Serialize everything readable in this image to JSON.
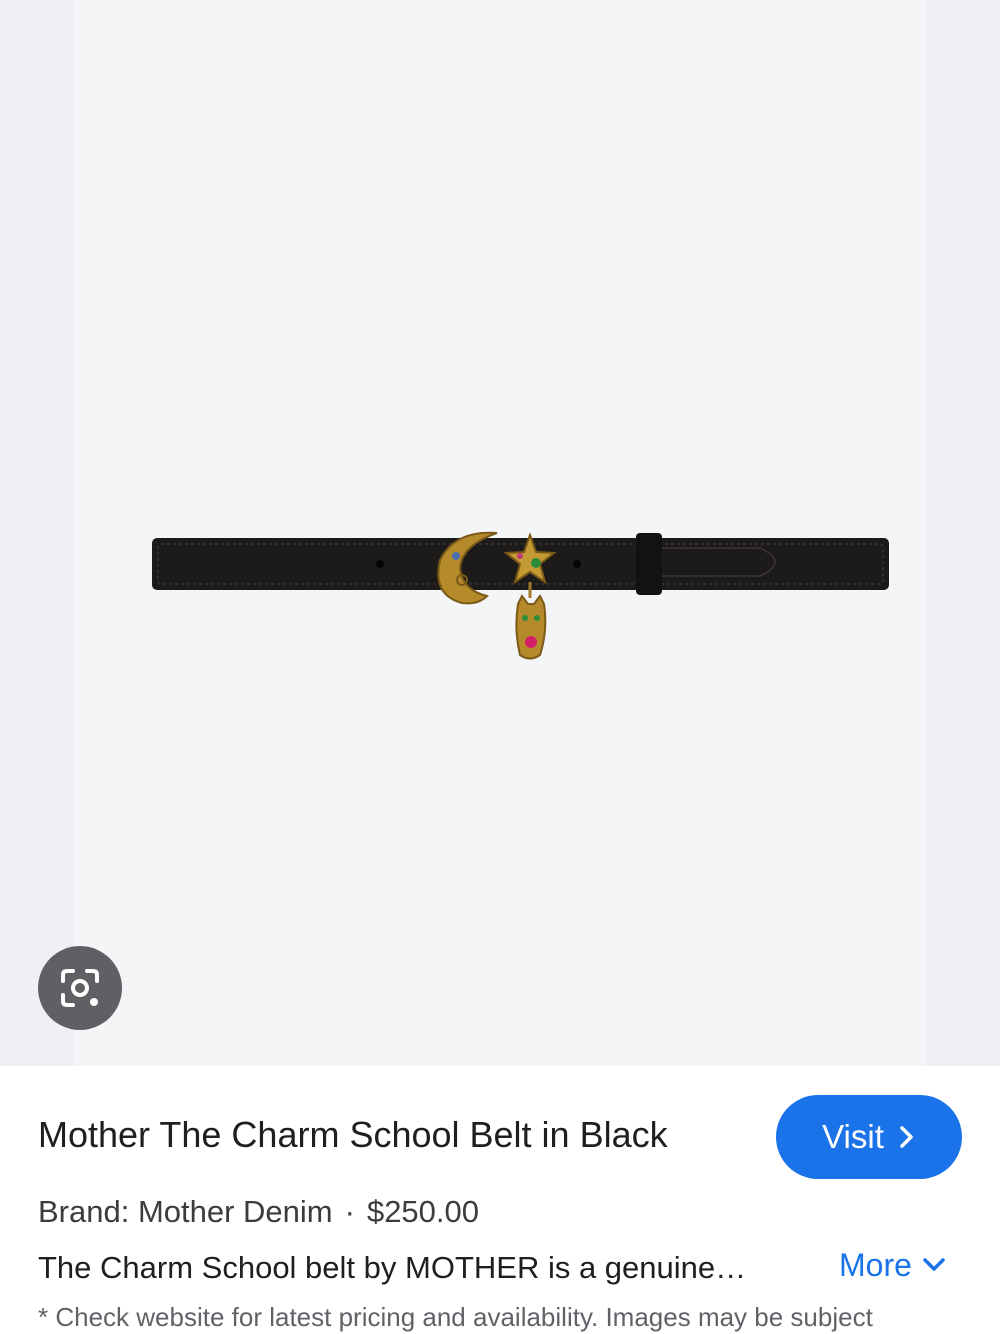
{
  "image": {
    "alt": "Mother The Charm School Belt in Black",
    "lens_icon": "google-lens-icon"
  },
  "product": {
    "title": "Mother The Charm School Belt in Black",
    "visit_label": "Visit",
    "visit_icon": "chevron-right-icon",
    "brand_text": "Brand: Mother Denim",
    "separator": "·",
    "price": "$250.00",
    "description": "The Charm School belt by MOTHER is a genuine…",
    "more_label": "More",
    "more_icon": "chevron-down-icon",
    "disclaimer": "* Check website for latest pricing and availability. Images may be subject"
  },
  "colors": {
    "accent": "#1a73e8",
    "lens_button": "#5f6063"
  }
}
